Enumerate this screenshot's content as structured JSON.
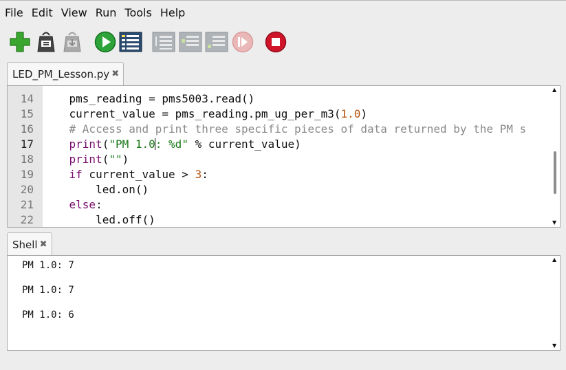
{
  "menubar": [
    "File",
    "Edit",
    "View",
    "Run",
    "Tools",
    "Help"
  ],
  "toolbar": {
    "buttons": [
      {
        "name": "new-file",
        "icon": "plus-icon",
        "color": "#3aa52f"
      },
      {
        "name": "load-file",
        "icon": "open-bag-icon",
        "color": "#333333"
      },
      {
        "name": "save-file",
        "icon": "save-bag-icon",
        "color": "#9a9a9a"
      },
      {
        "name": "run",
        "icon": "play-icon",
        "color": "#2ea33a"
      },
      {
        "name": "debug",
        "icon": "debug-list-icon",
        "color": "#2a4b6f"
      },
      {
        "name": "step-over",
        "icon": "step-over-icon",
        "color": "#9aa0a6"
      },
      {
        "name": "step-into",
        "icon": "step-into-icon",
        "color": "#9aa0a6"
      },
      {
        "name": "step-out",
        "icon": "step-out-icon",
        "color": "#9aa0a6"
      },
      {
        "name": "resume",
        "icon": "resume-icon",
        "color": "#e2a3a3"
      },
      {
        "name": "stop",
        "icon": "stop-icon",
        "color": "#d0152a"
      }
    ]
  },
  "editor": {
    "tab_label": "LED_PM_Lesson.py",
    "tab_close": "✖",
    "lines": [
      {
        "num": "14",
        "tokens": [
          {
            "t": "    pms_reading = pms5003.read()",
            "c": ""
          }
        ]
      },
      {
        "num": "15",
        "tokens": [
          {
            "t": "    current_value = pms_reading.pm_ug_per_m3(",
            "c": ""
          },
          {
            "t": "1.0",
            "c": "num"
          },
          {
            "t": ")",
            "c": ""
          }
        ]
      },
      {
        "num": "16",
        "tokens": [
          {
            "t": "    # Access and print three specific pieces of data returned by the PM s",
            "c": "cmt"
          }
        ]
      },
      {
        "num": "17",
        "current": true,
        "tokens": [
          {
            "t": "    ",
            "c": ""
          },
          {
            "t": "print",
            "c": "kw"
          },
          {
            "t": "(",
            "c": ""
          },
          {
            "t": "\"PM 1.0",
            "c": "str"
          },
          {
            "t": "|",
            "c": "caret"
          },
          {
            "t": ": %d\"",
            "c": "str"
          },
          {
            "t": " % current_value)",
            "c": ""
          }
        ]
      },
      {
        "num": "18",
        "tokens": [
          {
            "t": "    ",
            "c": ""
          },
          {
            "t": "print",
            "c": "kw"
          },
          {
            "t": "(",
            "c": ""
          },
          {
            "t": "\"\"",
            "c": "str"
          },
          {
            "t": ")",
            "c": ""
          }
        ]
      },
      {
        "num": "19",
        "tokens": [
          {
            "t": "    ",
            "c": ""
          },
          {
            "t": "if",
            "c": "kw"
          },
          {
            "t": " current_value > ",
            "c": ""
          },
          {
            "t": "3",
            "c": "num"
          },
          {
            "t": ":",
            "c": ""
          }
        ]
      },
      {
        "num": "20",
        "tokens": [
          {
            "t": "        led.on()",
            "c": ""
          }
        ]
      },
      {
        "num": "21",
        "tokens": [
          {
            "t": "    ",
            "c": ""
          },
          {
            "t": "else",
            "c": "kw"
          },
          {
            "t": ":",
            "c": ""
          }
        ]
      },
      {
        "num": "22",
        "tokens": [
          {
            "t": "        led.off()",
            "c": ""
          }
        ]
      }
    ],
    "scroll_fraction": 0.7
  },
  "shell": {
    "tab_label": "Shell",
    "tab_close": "✖",
    "lines": [
      "PM 1.0: 7",
      "PM 1.0: 7",
      "PM 1.0: 6"
    ]
  }
}
